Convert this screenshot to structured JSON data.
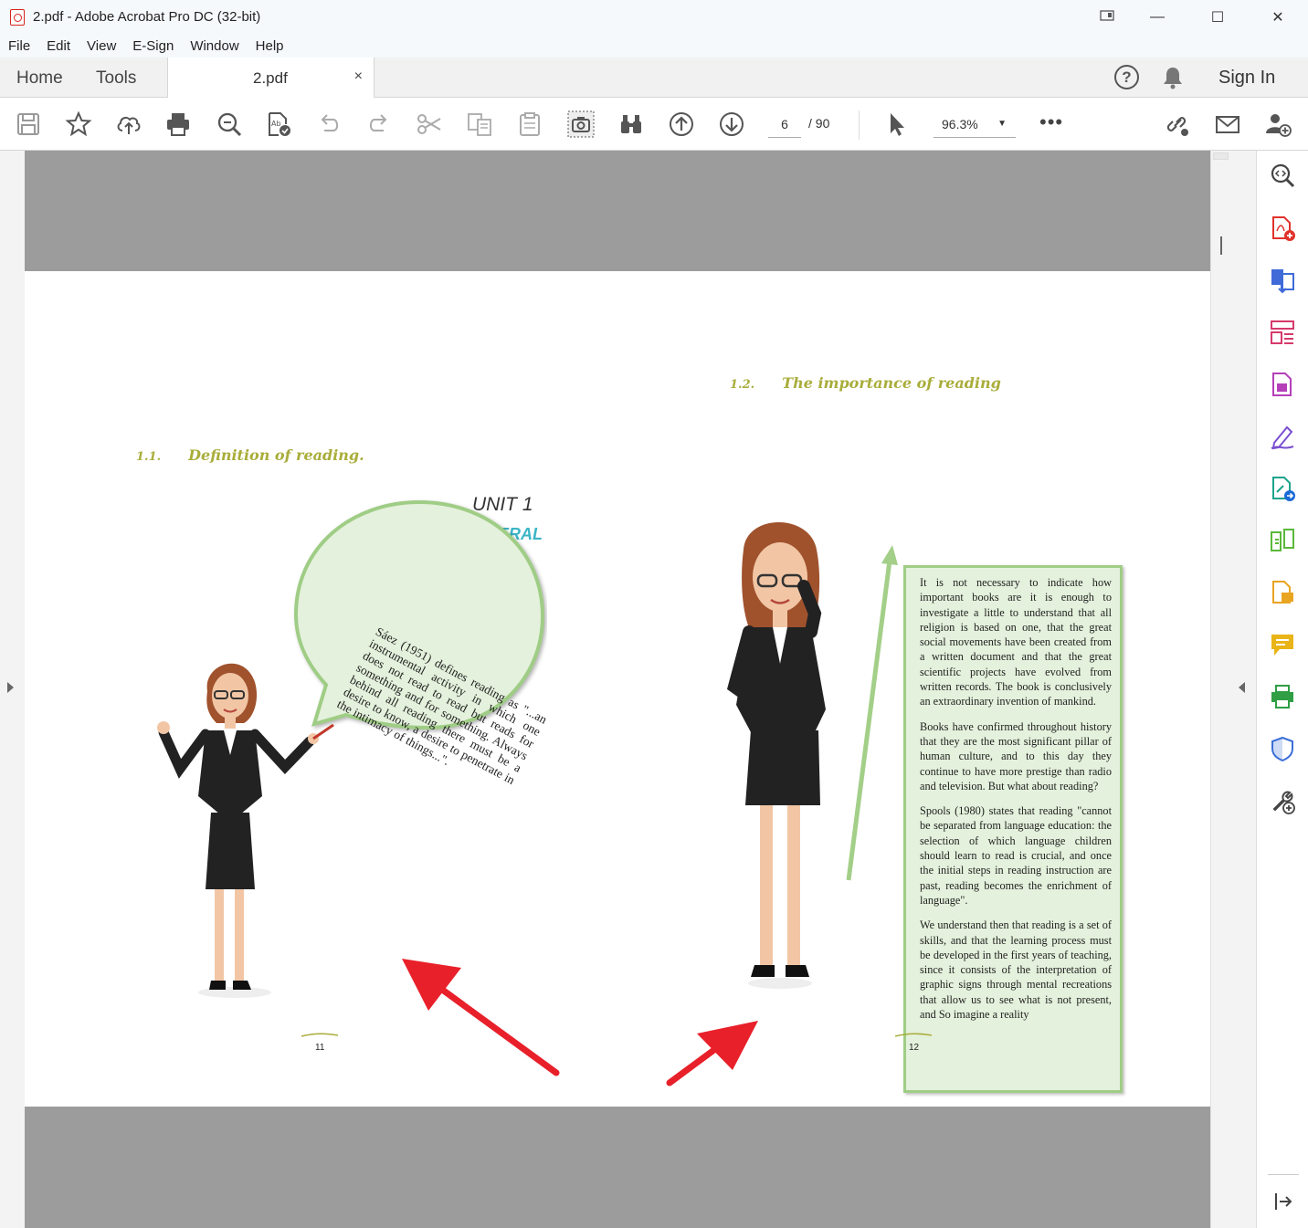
{
  "window": {
    "title": "2.pdf - Adobe Acrobat Pro DC (32-bit)",
    "controls": [
      "—",
      "☐",
      "✕"
    ]
  },
  "menu": [
    "File",
    "Edit",
    "View",
    "E-Sign",
    "Window",
    "Help"
  ],
  "tabs": {
    "home": "Home",
    "tools": "Tools",
    "document": "2.pdf",
    "close": "×",
    "help": "?",
    "sign_in": "Sign In"
  },
  "toolbar": {
    "page_current": "6",
    "page_total": "/ 90",
    "zoom": "96.3%",
    "zoom_caret": "▼",
    "more": "•••"
  },
  "document": {
    "left_page": {
      "unit": "UNIT 1",
      "unit_subtitle": "READING IN GENERAL",
      "section_num": "1.1.",
      "section_title": "Definition of reading.",
      "bubble": "Sáez (1951) defines reading as \"...an instrumental activity in which one does not read to read but reads for something and for something. Always behind all reading there must be a desire to know, a desire to penetrate in the intimacy of things...\".",
      "page_number": "11"
    },
    "right_page": {
      "section_num": "1.2.",
      "section_title": "The importance of reading",
      "paragraphs": [
        "It is not necessary to indicate how important books are it is enough to investigate a little to understand that all religion is based on one, that the great social movements have been created from a written document and that the great scientific projects have evolved from written records. The book is conclusively an extraordinary invention of mankind.",
        "Books have confirmed throughout history that they are the most significant pillar of human culture, and to this day they continue to have more prestige than radio and television. But what about reading?",
        "Spools (1980) states that reading \"cannot be separated from language education: the selection of which language children should learn to read is crucial, and once the initial steps in reading instruction are past, reading becomes the enrichment of language\".",
        "We understand then that reading is a set of skills, and that the learning process must be developed in the first years of teaching, since it consists of the interpretation of graphic signs through mental recreations that allow us to see what is not present, and So imagine a reality"
      ],
      "page_number": "12"
    }
  },
  "colors": {
    "accent_teal": "#3bb5c6",
    "section_olive": "#a9ad3a",
    "bubble_fill": "#e4f1dc",
    "bubble_border": "#9fcd85",
    "annotation_arrow": "#e8202a"
  }
}
